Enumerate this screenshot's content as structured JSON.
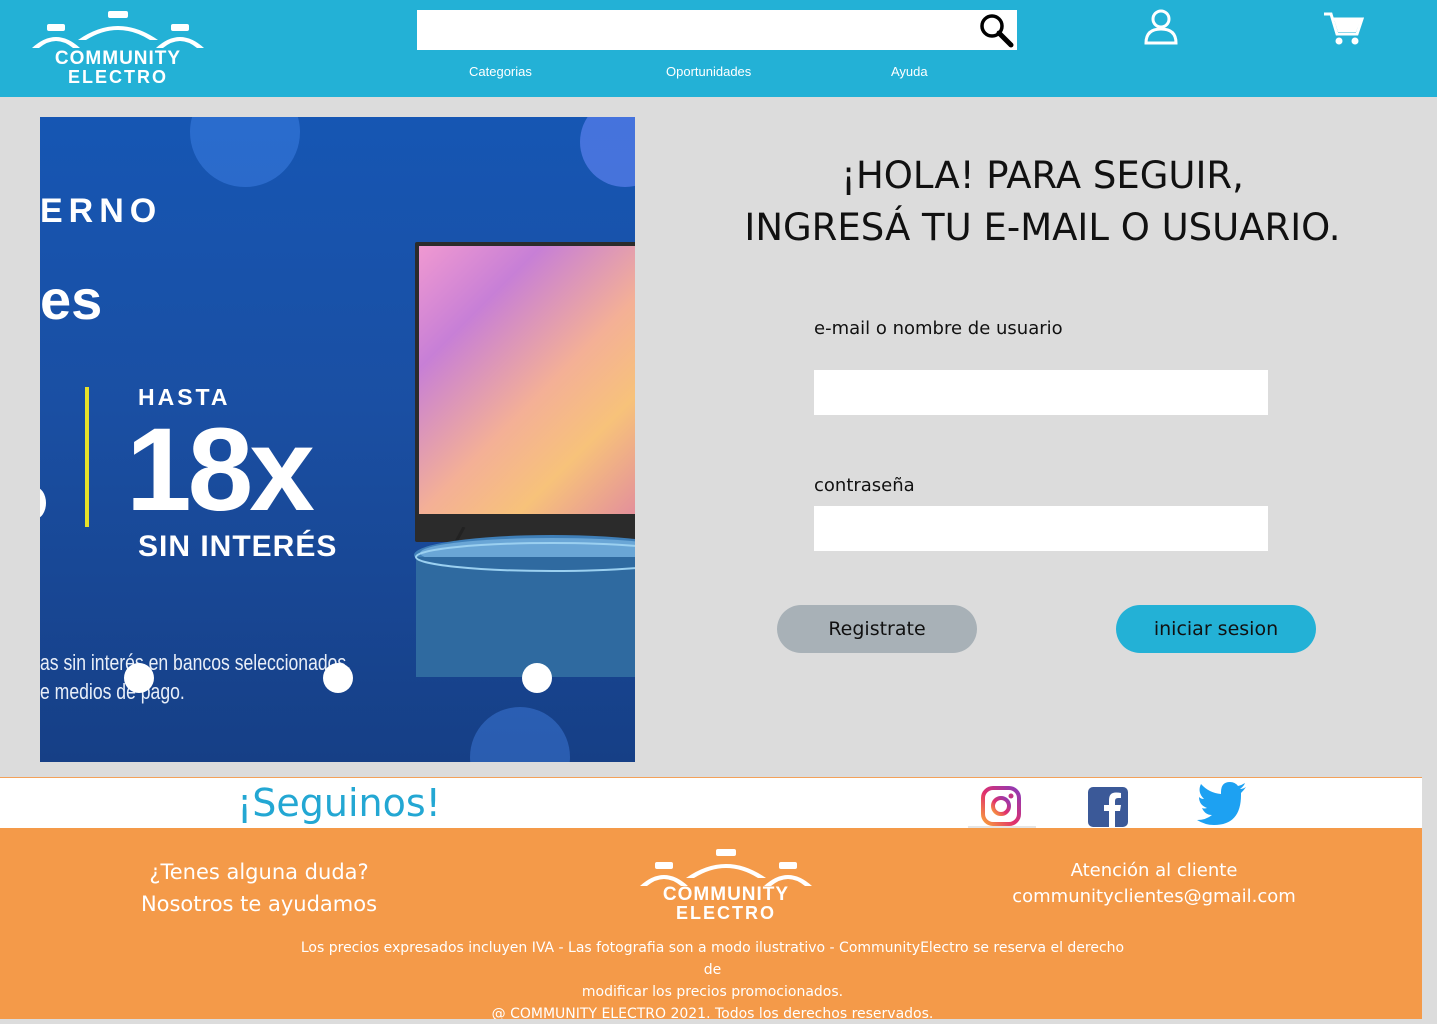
{
  "header": {
    "logo_line1": "COMMUNITY",
    "logo_line2": "ELECTRO",
    "search_placeholder": "",
    "nav": [
      "Categorias",
      "Oportunidades",
      "Ayuda"
    ],
    "icons": [
      "search-icon",
      "user-icon",
      "cart-icon"
    ],
    "color": "#23b1d6"
  },
  "banner": {
    "text_top": "ERNO",
    "text_es": "es",
    "hasta": "HASTA",
    "big": "18x",
    "sin_interes": "SIN INTERÉS",
    "fine_line1": "as sin interés en bancos seleccionados.",
    "fine_line2": "e medios de pago.",
    "carousel_dots": 3
  },
  "login": {
    "title_line1": "¡HOLA! PARA SEGUIR,",
    "title_line2": "INGRESÁ TU E-MAIL O USUARIO.",
    "email_label": "e-mail o nombre de usuario",
    "email_value": "",
    "password_label": "contraseña",
    "password_value": "",
    "register_button": "Registrate",
    "login_button": "iniciar sesion"
  },
  "follow": {
    "title": "¡Seguinos!",
    "icons": [
      "instagram-icon",
      "facebook-icon",
      "twitter-icon"
    ]
  },
  "footer": {
    "help_line1": "¿Tenes alguna duda?",
    "help_line2": "Nosotros te ayudamos",
    "logo_line1": "COMMUNITY",
    "logo_line2": "ELECTRO",
    "contact_title": "Atención al cliente",
    "contact_email": "communityclientes@gmail.com",
    "legal_line1": "Los precios expresados incluyen IVA - Las fotografia son a modo ilustrativo - CommunityElectro se reserva el derecho de",
    "legal_line2": "modificar los precios promocionados.",
    "legal_line3": "@ COMMUNITY ELECTRO 2021. Todos los derechos reservados.",
    "color": "#f49a49"
  }
}
